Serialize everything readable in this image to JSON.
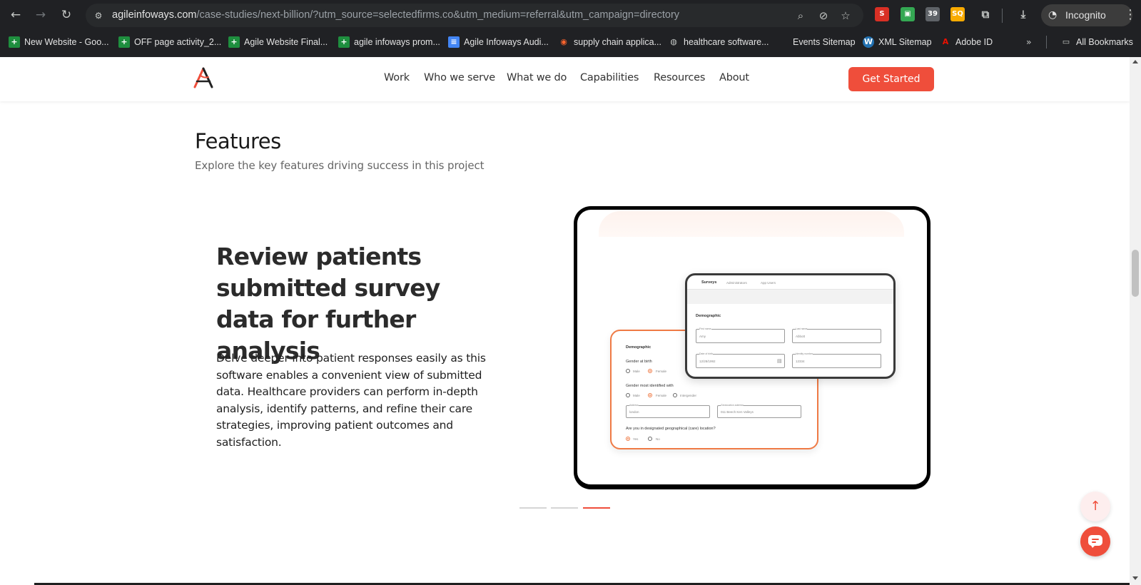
{
  "browser": {
    "url_host": "agileinfoways.com",
    "url_path": "/case-studies/next-billion/?utm_source=selectedfirms.co&utm_medium=referral&utm_campaign=directory",
    "profile_label": "Incognito",
    "bookmarks": [
      {
        "label": "New Website - Goo...",
        "icon": "google-sheets-icon",
        "color": "#1e8e3e"
      },
      {
        "label": "OFF page activity_2...",
        "icon": "google-sheets-icon",
        "color": "#1e8e3e"
      },
      {
        "label": "Agile Website Final...",
        "icon": "google-sheets-icon",
        "color": "#1e8e3e"
      },
      {
        "label": "agile infoways prom...",
        "icon": "google-sheets-icon",
        "color": "#1e8e3e"
      },
      {
        "label": "Agile Infoways Audi...",
        "icon": "google-docs-icon",
        "color": "#4285f4"
      },
      {
        "label": "supply chain applica...",
        "icon": "semrush-icon",
        "color": "#ff642d"
      },
      {
        "label": "healthcare software...",
        "icon": "globe-icon",
        "color": "#9aa0a6"
      },
      {
        "label": "Events Sitemap",
        "icon": "",
        "color": ""
      },
      {
        "label": "XML Sitemap",
        "icon": "wordpress-icon",
        "color": "#2271b1"
      },
      {
        "label": "Adobe ID",
        "icon": "adobe-icon",
        "color": "#eb1000"
      },
      {
        "label": "All Bookmarks",
        "icon": "folder-icon",
        "color": "#c4c7c5"
      }
    ],
    "extension_badge": "39"
  },
  "site": {
    "nav": [
      "Work",
      "Who we serve",
      "What we do",
      "Capabilities",
      "Resources",
      "About"
    ],
    "cta_label": "Get Started",
    "accent_color": "#ef4e3b"
  },
  "features": {
    "title": "Features",
    "subtitle": "Explore the key features driving success in this project"
  },
  "slide": {
    "heading": "Review patients submitted survey data for further analysis",
    "body": "Delve deeper into patient responses easily as this software enables a convenient view of submitted data. Healthcare providers can perform in-depth analysis, identify patterns, and refine their care strategies, improving patient outcomes and satisfaction.",
    "active_index": 2,
    "total": 3
  },
  "mockup": {
    "front": {
      "tabs": [
        "Surveys",
        "Administrators",
        "App Users"
      ],
      "section": "Demographic",
      "fields": [
        {
          "label": "First name",
          "value": "Amy"
        },
        {
          "label": "Last name",
          "value": "Abbott"
        },
        {
          "label": "Date of birth",
          "value": "12/28/1992"
        },
        {
          "label": "Identity number",
          "value": "12334"
        }
      ]
    },
    "back": {
      "section": "Demographic",
      "q_gender_birth": "Gender at birth",
      "q_gender_identified": "Gender most identified with",
      "opt_male": "Male",
      "opt_female": "Female",
      "opt_intergender": "Intergender",
      "address_label": "Address",
      "address_value": "london",
      "address2_label": "Geolocation address",
      "address2_value": "011 Beech Ken Valleys",
      "q_location": "Are you in designated geographical (care) location?",
      "opt_yes": "Yes",
      "opt_no": "No"
    }
  }
}
